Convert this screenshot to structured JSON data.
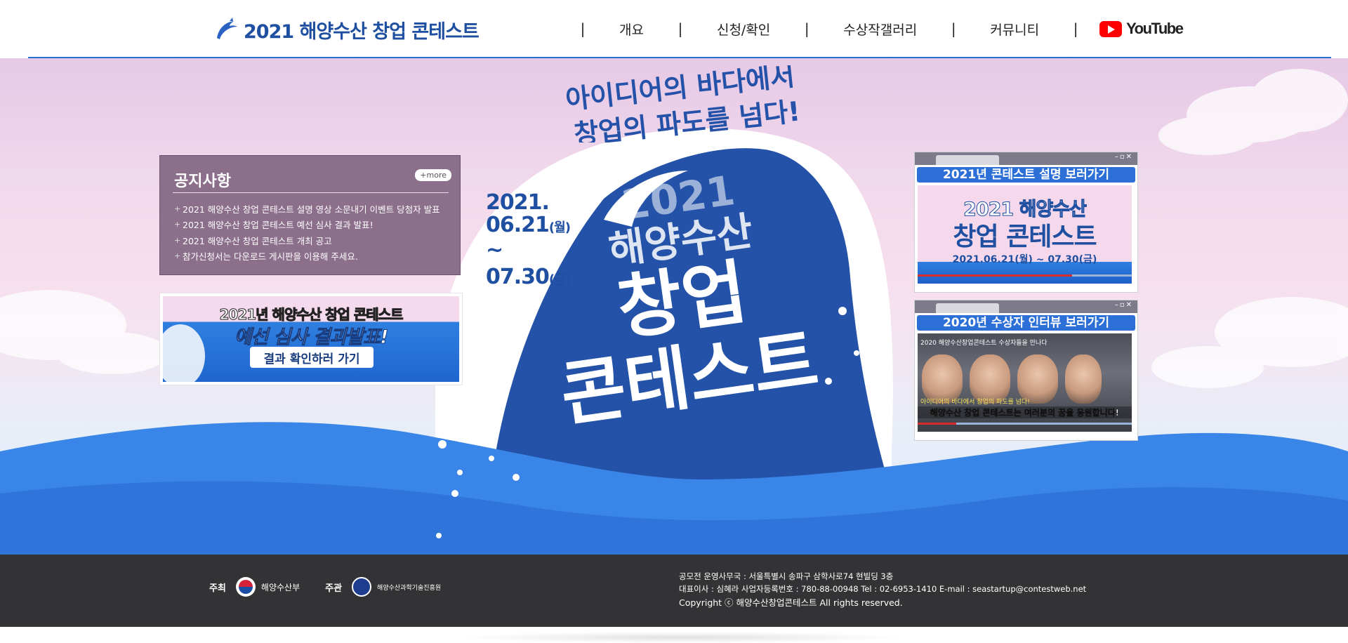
{
  "header": {
    "logo_text": "2021 해양수산 창업 콘테스트",
    "nav": [
      {
        "label": "개요"
      },
      {
        "label": "신청/확인"
      },
      {
        "label": "수상작갤러리"
      },
      {
        "label": "커뮤니티"
      }
    ],
    "separator": "|",
    "youtube_label": "YouTube"
  },
  "hero": {
    "slogan_line1": "아이디어의 바다에서",
    "slogan_line2": "창업의 파도를 넘다!",
    "date_start_year": "2021.",
    "date_start": "06.21",
    "date_start_dow": "(월)",
    "date_dash": "~",
    "date_end": "07.30",
    "date_end_dow": "(금)",
    "title_year": "2021",
    "title_line1": "해양수산",
    "title_line2": "창업",
    "title_line3": "콘테스트"
  },
  "notice": {
    "title": "공지사항",
    "more": "+more",
    "items": [
      "2021 해양수산 창업 콘테스트 설명 영상 소문내기 이벤트 당첨자 발표",
      "2021 해양수산 창업 콘테스트 예선 심사 결과 발표!",
      "2021 해양수산 창업 콘테스트 개최 공고",
      "참가신청서는 다운로드 게시판을 이용해 주세요."
    ]
  },
  "banner": {
    "line1": "2021년 해양수산 창업 콘테스트",
    "line2": "예선 심사 결과발표!",
    "button": "결과 확인하러 가기"
  },
  "video1": {
    "title": "2021년 콘테스트 설명 보러가기",
    "line1": "2021 해양수산",
    "line2": "창업 콘테스트",
    "line3": "2021.06.21(월) ~ 07.30(금)",
    "progress": 0.72
  },
  "video2": {
    "title": "2020년 수상자 인터뷰 보러가기",
    "caption": "2020 해양수산창업콘테스트 수상자들을 만나다",
    "sub1": "아이디어의 바다에서 창업의 파도를 넘다!",
    "sub2": "해양수산 창업 콘테스트는 여러분의 꿈을 응원합니다!",
    "progress": 0.18
  },
  "footer": {
    "host_label": "주최",
    "host_org": "해양수산부",
    "organizer_label": "주관",
    "organizer_org": "해양수산과학기술진흥원",
    "line1": "공모전 운영사무국 : 서울특별시 송파구 삼학사로74 현빌딩 3층",
    "line2": "대표이사 : 심혜라  사업자등록번호 : 780-88-00948  Tel : 02-6953-1410   E-mail : seastartup@contestweb.net",
    "copyright": "Copyright ⓒ 해양수산창업콘테스트 All rights reserved."
  },
  "colors": {
    "brand_blue": "#1f4fa0",
    "wave_blue": "#2f7fe0",
    "notice_bg": "#8b6f8b",
    "footer_bg": "#333335"
  }
}
